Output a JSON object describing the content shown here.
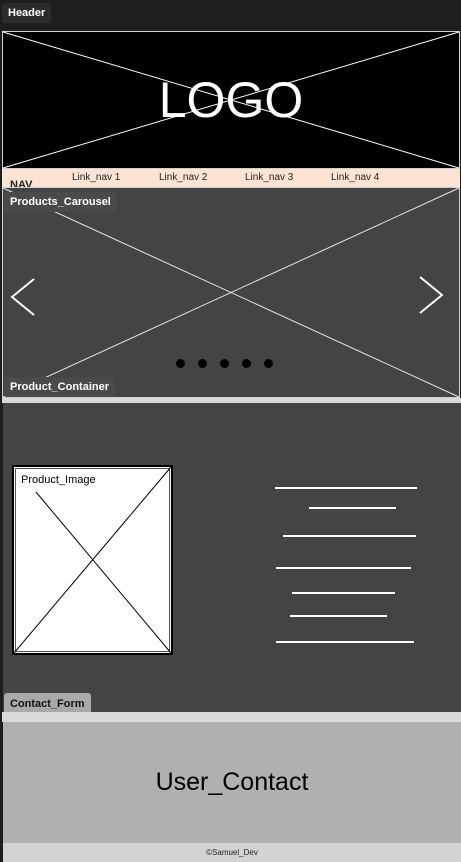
{
  "header": {
    "tag": "Header",
    "logo_text": "LOGO"
  },
  "nav": {
    "tag": "NAV",
    "links": [
      "Link_nav 1",
      "Link_nav 2",
      "Link_nav 3",
      "Link_nav 4"
    ]
  },
  "carousel": {
    "tag": "Products_Carousel",
    "prev_glyph": "<",
    "next_glyph": ">",
    "dot_count": 5
  },
  "product": {
    "tag": "Product_Container",
    "image_label": "Product_Image",
    "text_lines": 7
  },
  "contact": {
    "tag": "Contact_Form",
    "title": "User_Contact"
  },
  "footer": {
    "copyright": "©Samuel_Dev"
  },
  "colors": {
    "page_bg": "#1e1e1e",
    "header_bg": "#000000",
    "nav_bg": "#fde3d3",
    "section_bg": "#444444",
    "contact_bg": "#b0b0b0",
    "footer_bg": "#d3d3d3"
  }
}
